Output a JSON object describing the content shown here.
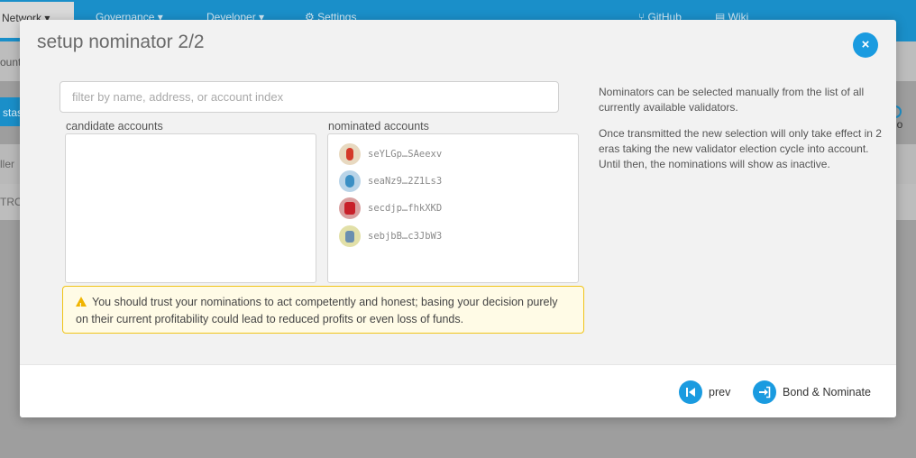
{
  "background": {
    "nav": [
      "Network",
      "Governance",
      "Developer",
      "Settings",
      "GitHub",
      "Wiki"
    ],
    "subnav_label": "ount",
    "button_fragment": "stas",
    "right_label": "No",
    "filter_fragment": "ller",
    "row_fragment": "TRO"
  },
  "modal": {
    "title": "setup nominator 2/2",
    "close_icon": "×",
    "filter_placeholder": "filter by name, address, or account index",
    "candidate_label": "candidate accounts",
    "nominated_label": "nominated accounts",
    "nominated": [
      {
        "name": "seYLGp…SAeexv",
        "colors": [
          "#e8d9c0",
          "#d43a2a"
        ]
      },
      {
        "name": "seaNz9…2Z1Ls3",
        "colors": [
          "#b9d4e8",
          "#3b8fc4"
        ]
      },
      {
        "name": "secdjp…fhkXKD",
        "colors": [
          "#d9a0a0",
          "#c8202a"
        ]
      },
      {
        "name": "sebjbB…c3JbW3",
        "colors": [
          "#e2e0a8",
          "#6a8fb0"
        ]
      }
    ],
    "warning": "You should trust your nominations to act competently and honest; basing your decision purely on their current profitability could lead to reduced profits or even loss of funds.",
    "help_1": "Nominators can be selected manually from the list of all currently available validators.",
    "help_2": "Once transmitted the new selection will only take effect in 2 eras taking the new validator election cycle into account. Until then, the nominations will show as inactive.",
    "prev_label": "prev",
    "submit_label": "Bond & Nominate"
  },
  "colors": {
    "accent": "#1a9be0",
    "warning_border": "#f0c419",
    "warning_bg": "#fffbe6"
  }
}
